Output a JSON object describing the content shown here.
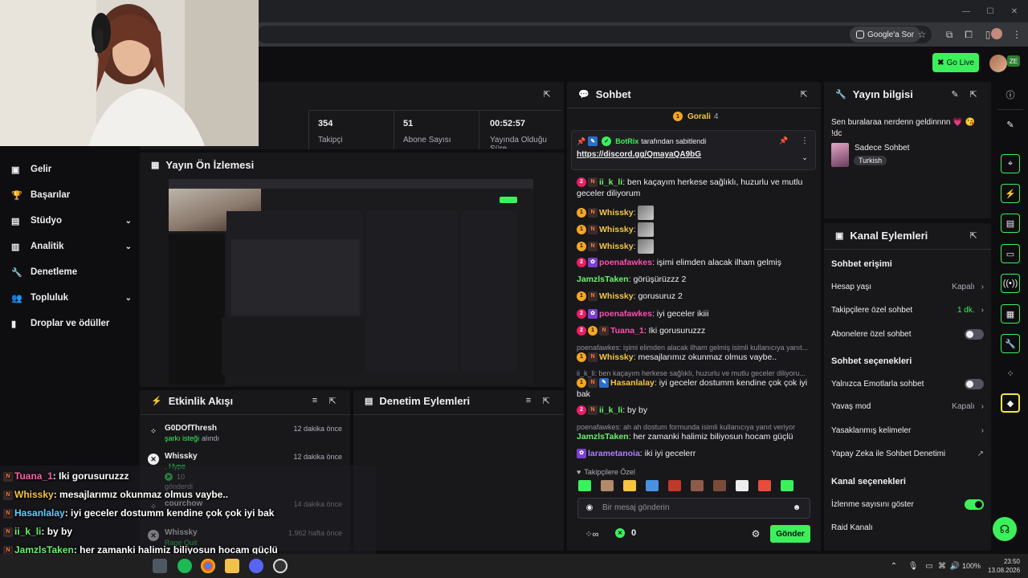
{
  "browser": {
    "google_ask": "Google'a Sor"
  },
  "header": {
    "go_live": "Go Live",
    "avatar_badge": "ZE"
  },
  "sidebar": {
    "items": [
      {
        "label": "Gelir",
        "icon": "money-icon",
        "chevron": false
      },
      {
        "label": "Başarılar",
        "icon": "trophy-icon",
        "chevron": false
      },
      {
        "label": "Stüdyo",
        "icon": "studio-icon",
        "chevron": true
      },
      {
        "label": "Analitik",
        "icon": "analytics-icon",
        "chevron": true
      },
      {
        "label": "Denetleme",
        "icon": "wrench-icon",
        "chevron": false
      },
      {
        "label": "Topluluk",
        "icon": "community-icon",
        "chevron": true
      },
      {
        "label": "Droplar ve ödüller",
        "icon": "drops-icon",
        "chevron": false
      }
    ]
  },
  "stats": [
    {
      "value": "354",
      "label": "Takipçi"
    },
    {
      "value": "51",
      "label": "Abone Sayısı"
    },
    {
      "value": "00:52:57",
      "label": "Yayında Olduğu Süre"
    }
  ],
  "preview": {
    "title": "Yayın Ön İzlemesi"
  },
  "activity": {
    "title": "Etkinlik Akışı",
    "items": [
      {
        "name": "G0DOfThresh",
        "time": "12 dakika önce",
        "line1": "şarkı isteği",
        "line1b": "alındı",
        "line2": ""
      },
      {
        "name": "Whissky",
        "time": "12 dakika önce",
        "line1": ", Hype",
        "line1b": "",
        "line2": "10",
        "line3": "gönderdi"
      },
      {
        "name": "courchow",
        "time": "14 dakika önce",
        "line1": "",
        "line1b": "",
        "line2": ""
      },
      {
        "name": "Whissky",
        "time": "1.962 hafta önce",
        "line1": "Rage Quit",
        "line1b": "",
        "line2": ""
      }
    ]
  },
  "moderation": {
    "title": "Denetim Eylemleri"
  },
  "chat": {
    "title": "Sohbet",
    "leader_name": "Gorali",
    "leader_count": "4",
    "pinned_by": "BotRix",
    "pinned_suffix": "tarafından sabitlendi",
    "pinned_link": "https://discord.gg/QmayaQA9bG",
    "messages": [
      {
        "user": "ii_k_li",
        "cls": "u-green",
        "text": "ben kaçayım herkese sağlıklı, huzurlu ve mutlu geceler diliyorum",
        "reply": ""
      },
      {
        "user": "Whissky",
        "cls": "u-yellow",
        "text": "",
        "reply": ""
      },
      {
        "user": "Whissky",
        "cls": "u-yellow",
        "text": "",
        "reply": ""
      },
      {
        "user": "Whissky",
        "cls": "u-yellow",
        "text": "",
        "reply": ""
      },
      {
        "user": "poenafawkes",
        "cls": "u-pink",
        "text": "işimi elimden alacak ilham gelmiş",
        "reply": ""
      },
      {
        "user": "JamzlsTaken",
        "cls": "u-green",
        "text": "görüşürüzzz 2",
        "reply": ""
      },
      {
        "user": "Whissky",
        "cls": "u-yellow",
        "text": "gorusuruz 2",
        "reply": ""
      },
      {
        "user": "poenafawkes",
        "cls": "u-pink",
        "text": "iyi geceler ikiii",
        "reply": ""
      },
      {
        "user": "Tuana_1",
        "cls": "u-pink",
        "text": "Iki gorusuruzzz",
        "reply": ""
      },
      {
        "user": "Whissky",
        "cls": "u-yellow",
        "text": "mesajlarımız okunmaz olmus vaybe..",
        "reply": "poenafawkes: işimi elimden alacak ilham gelmiş isimli kullanıcıya yanıt..."
      },
      {
        "user": "Hasanlalay",
        "cls": "u-yellow",
        "text": "iyi geceler dostumm kendine çok çok iyi bak",
        "reply": "ii_k_li: ben kaçayım herkese sağlıklı, huzurlu ve mutlu geceler diliyoru..."
      },
      {
        "user": "ii_k_li",
        "cls": "u-green",
        "text": "by by",
        "reply": ""
      },
      {
        "user": "JamzlsTaken",
        "cls": "u-green",
        "text": "her zamanki halimiz biliyosun hocam güçlü",
        "reply": "poenafawkes: ah ah dostum formunda isimli kullanıcıya yanıt veriyor"
      },
      {
        "user": "larametanoia",
        "cls": "u-purple",
        "text": "iki iyi gecelerr",
        "reply": ""
      }
    ],
    "followers_only": "Takipçilere Özel",
    "input_placeholder": "Bir mesaj gönderin",
    "points": "0",
    "send": "Gönder"
  },
  "stream_info": {
    "title": "Yayın bilgisi",
    "stream_title": "Sen buralaraa nerdenn geldinnnn 💗 😘 !dc",
    "category": "Sadece Sohbet",
    "tag": "Turkish"
  },
  "channel_actions": {
    "title": "Kanal Eylemleri",
    "chat_access_header": "Sohbet erişimi",
    "account_age_label": "Hesap yaşı",
    "account_age_value": "Kapalı",
    "followers_chat_label": "Takipçilere özel sohbet",
    "followers_chat_value": "1 dk.",
    "subs_chat_label": "Abonelere özel sohbet",
    "chat_options_header": "Sohbet seçenekleri",
    "emote_only_label": "Yalnızca Emotlarla sohbet",
    "slow_mode_label": "Yavaş mod",
    "slow_mode_value": "Kapalı",
    "banned_words_label": "Yasaklanmış kelimeler",
    "ai_mod_label": "Yapay Zeka ile Sohbet Denetimi",
    "channel_options_header": "Kanal seçenekleri",
    "show_views_label": "İzlenme sayısını göster",
    "raid_label": "Raid Kanalı"
  },
  "overlay_chat": [
    {
      "user": "Tuana_1",
      "color": "#ff5fa8",
      "text": ": Iki gorusuruzzz"
    },
    {
      "user": "Whissky",
      "color": "#f5c542",
      "text": ": mesajlarımız okunmaz olmus vaybe.."
    },
    {
      "user": "Hasanlalay",
      "color": "#5ad1ff",
      "text": ": iyi geceler dostumm kendine çok çok iyi bak"
    },
    {
      "user": "ii_k_li",
      "color": "#6cf26c",
      "text": ": by by"
    },
    {
      "user": "JamzlsTaken",
      "color": "#6cf26c",
      "text": ": her zamanki halimiz biliyosun hocam güçlü"
    },
    {
      "user": "larametanoia",
      "color": "#b07bff",
      "text": ": iki iyi gecelerr"
    }
  ],
  "taskbar": {
    "battery": "100%",
    "time": "23:50",
    "date": "13.08.2026"
  },
  "colors": {
    "accent": "#3cf05c",
    "panel": "#18181b",
    "background": "#0e0e10"
  }
}
